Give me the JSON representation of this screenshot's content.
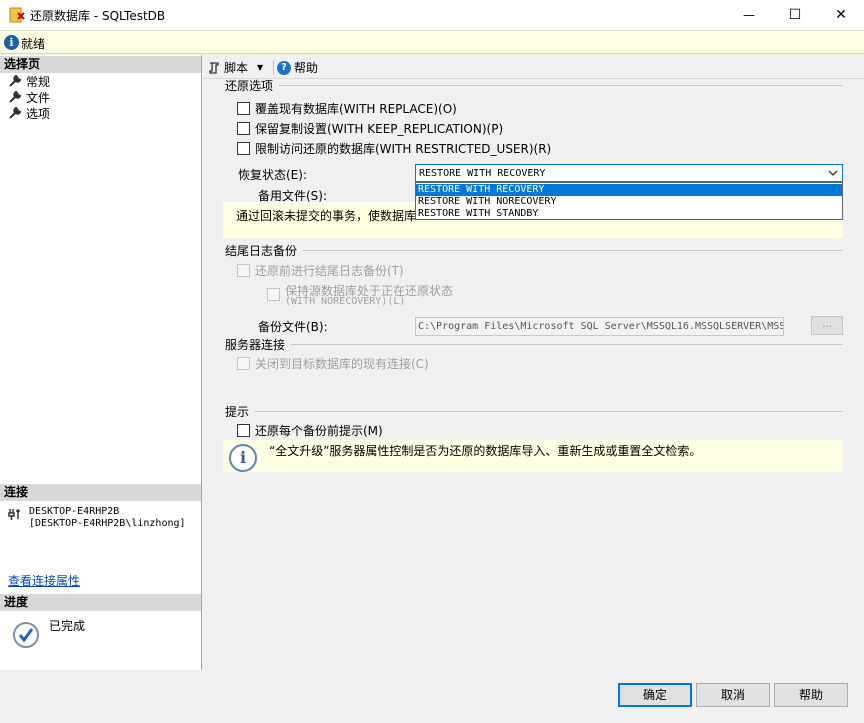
{
  "window": {
    "title": "还原数据库 - SQLTestDB",
    "minimize_glyph": "—",
    "maximize_glyph": "☐",
    "close_glyph": "✕"
  },
  "status": {
    "text": "就绪",
    "icon": "info-icon"
  },
  "left": {
    "select_page_header": "选择页",
    "pages": [
      {
        "label": "常规",
        "icon": "wrench-icon"
      },
      {
        "label": "文件",
        "icon": "wrench-icon"
      },
      {
        "label": "选项",
        "icon": "wrench-icon"
      }
    ],
    "connection_header": "连接",
    "server": "DESKTOP-E4RHP2B",
    "login": "[DESKTOP-E4RHP2B\\linzhong]",
    "view_connection_link": "查看连接属性",
    "progress_header": "进度",
    "progress_status": "已完成"
  },
  "toolbar": {
    "script_label": "脚本",
    "help_label": "帮助"
  },
  "restore_options": {
    "title": "还原选项",
    "checkboxes": [
      {
        "label": "覆盖现有数据库(WITH REPLACE)(O)",
        "checked": false
      },
      {
        "label": "保留复制设置(WITH KEEP_REPLICATION)(P)",
        "checked": false
      },
      {
        "label": "限制访问还原的数据库(WITH RESTRICTED_USER)(R)",
        "checked": false
      }
    ],
    "recovery_state_label": "恢复状态(E):",
    "recovery_state_value": "RESTORE WITH RECOVERY",
    "recovery_options": [
      "RESTORE WITH RECOVERY",
      "RESTORE WITH NORECOVERY",
      "RESTORE WITH STANDBY"
    ],
    "standby_file_label": "备用文件(S):",
    "description": "通过回滚未提交的事务，使数据库"
  },
  "tail_log": {
    "title": "结尾日志备份",
    "take_backup_label": "还原前进行结尾日志备份(T)",
    "leave_restoring_line1": "保持源数据库处于正在还原状态",
    "leave_restoring_line2": "(WITH NORECOVERY)(L)",
    "backup_file_label": "备份文件(B):",
    "backup_file_value": "C:\\Program Files\\Microsoft SQL Server\\MSSQL16.MSSQLSERVER\\MSS",
    "browse_label": "..."
  },
  "server_connections": {
    "title": "服务器连接",
    "close_connections_label": "关闭到目标数据库的现有连接(C)"
  },
  "prompt": {
    "title": "提示",
    "prompt_before_label": "还原每个备份前提示(M)",
    "hint": "“全文升级”服务器属性控制是否为还原的数据库导入、重新生成或重置全文检索。"
  },
  "buttons": {
    "ok": "确定",
    "cancel": "取消",
    "help": "帮助"
  }
}
